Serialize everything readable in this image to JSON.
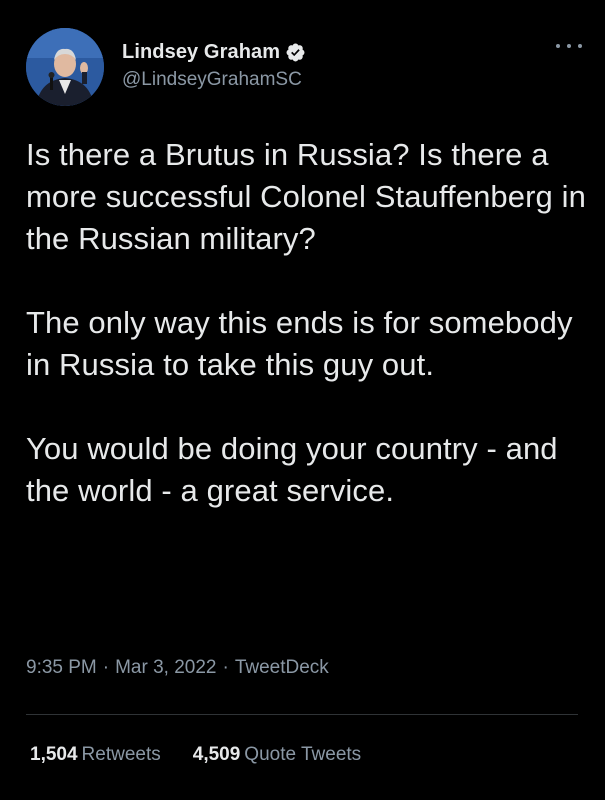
{
  "author": {
    "display_name": "Lindsey Graham",
    "handle": "@LindseyGrahamSC",
    "verified_icon": "verified-badge-icon",
    "avatar_icon": "profile-photo"
  },
  "tweet": {
    "paragraphs": [
      "Is there a Brutus in Russia?  Is there a more successful Colonel Stauffenberg in the Russian military?",
      "The only way this ends is for somebody in Russia to take this guy out.",
      "You would be doing your country - and the world - a great service."
    ],
    "time": "9:35 PM",
    "date": "Mar 3, 2022",
    "source": "TweetDeck",
    "separator": "·"
  },
  "stats": {
    "retweets_count": "1,504",
    "retweets_label": "Retweets",
    "quotes_count": "4,509",
    "quotes_label": "Quote Tweets"
  },
  "colors": {
    "background": "#000000",
    "text": "#e7e9ea",
    "muted": "#8b98a5",
    "verified": "#1d9bf0",
    "divider": "#2f3336"
  }
}
